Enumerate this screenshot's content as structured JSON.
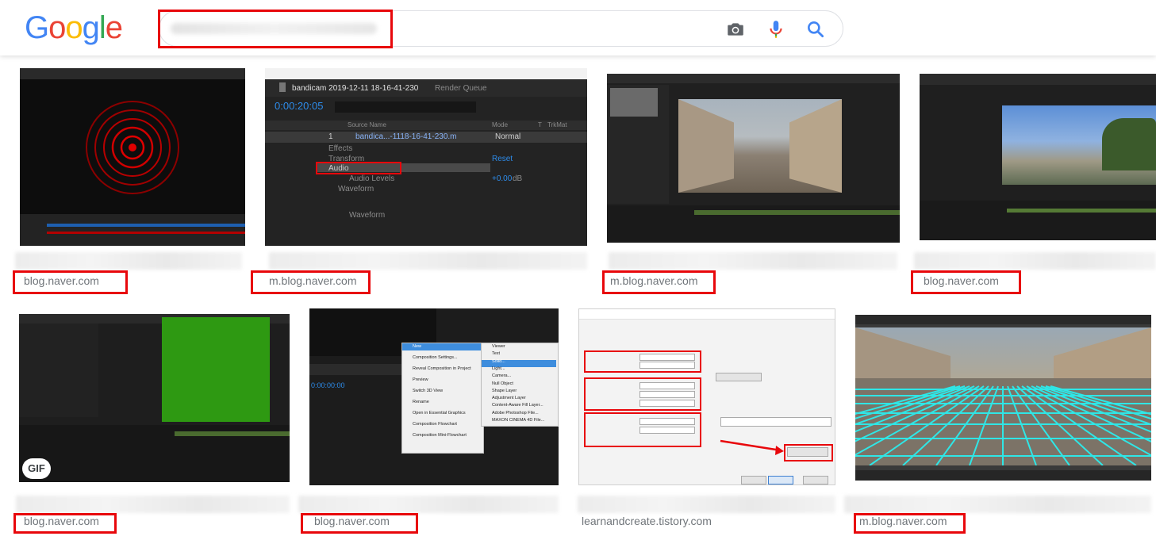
{
  "header": {
    "logo": [
      "G",
      "o",
      "o",
      "g",
      "l",
      "e"
    ],
    "logo_colors": [
      "#4285F4",
      "#EA4335",
      "#FBBC05",
      "#4285F4",
      "#34A853",
      "#EA4335"
    ],
    "search": {
      "value": "",
      "placeholder": ""
    },
    "icons": [
      "camera-icon",
      "microphone-icon",
      "search-icon"
    ],
    "annotation_color": "#e8070b"
  },
  "results": [
    {
      "source": "blog.naver.com",
      "highlighted": true
    },
    {
      "source": "m.blog.naver.com",
      "highlighted": true,
      "thumb_text": {
        "title": "bandicam 2019-12-11 18-16-41-230",
        "tab2": "Render Queue",
        "timecode": "0:00:20:05",
        "col_source": "Source Name",
        "col_mode": "Mode",
        "col_t": "T",
        "col_trkmat": "TrkMat",
        "layer_num": "1",
        "layer_name": "bandica...-1118-16-41-230.m",
        "mode_value": "Normal",
        "effects": "Effects",
        "transform": "Transform",
        "reset": "Reset",
        "audio": "Audio",
        "audio_levels": "Audio Levels",
        "db_value": "+0.00",
        "db_unit": "dB",
        "waveform": "Waveform",
        "waveform2": "Waveform"
      }
    },
    {
      "source": "m.blog.naver.com",
      "highlighted": true
    },
    {
      "source": "blog.naver.com",
      "highlighted": true
    },
    {
      "source": "blog.naver.com",
      "highlighted": true,
      "badge": "GIF"
    },
    {
      "source": "blog.naver.com",
      "highlighted": true,
      "thumb_text": {
        "timecode": "0:00:00:00",
        "menu_left": [
          "New",
          "Composition Settings...",
          "Reveal Composition in Project",
          "Preview",
          "Switch 3D View",
          "Rename",
          "Open in Essential Graphics",
          "Composition Flowchart",
          "Composition Mini-Flowchart"
        ],
        "menu_right": [
          "Viewer",
          "Text",
          "Solid...",
          "Light...",
          "Camera...",
          "Null Object",
          "Shape Layer",
          "Adjustment Layer",
          "Content-Aware Fill Layer...",
          "Adobe Photoshop File...",
          "MAXON CINEMA 4D File..."
        ]
      }
    },
    {
      "source": "learnandcreate.tistory.com",
      "highlighted": false
    },
    {
      "source": "m.blog.naver.com",
      "highlighted": true
    }
  ]
}
